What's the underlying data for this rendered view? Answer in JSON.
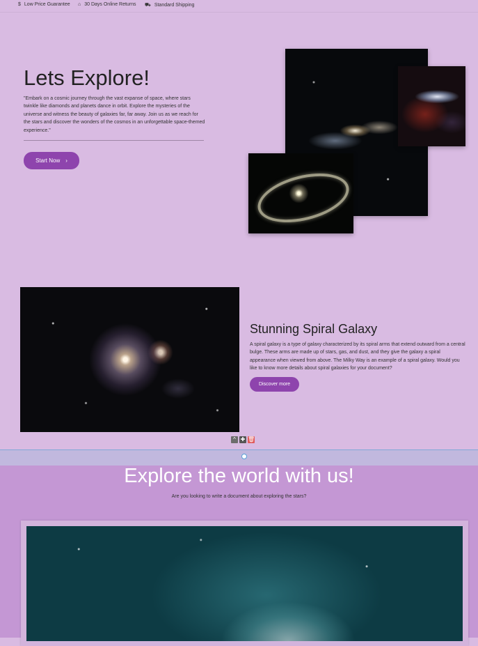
{
  "topbar": {
    "items": [
      {
        "icon": "dollar-icon",
        "glyph": "$",
        "label": "Low Price Guarantee"
      },
      {
        "icon": "store-icon",
        "glyph": "⌂",
        "label": "30 Days Online Returns"
      },
      {
        "icon": "truck-icon",
        "glyph": "⛟",
        "label": "Standard Shipping"
      }
    ]
  },
  "hero": {
    "title": "Lets Explore!",
    "text": "\"Embark on a cosmic journey through the vast expanse of space, where stars twinkle like diamonds and planets dance in orbit. Explore the mysteries of the universe and witness the beauty of galaxies far, far away. Join us as we reach for the stars and discover the wonders of the cosmos in an unforgettable space-themed experience.\"",
    "button_label": "Start Now",
    "button_icon": "chevron-right-icon"
  },
  "galaxy": {
    "title": "Stunning Spiral Galaxy",
    "text": "A spiral galaxy is a type of galaxy characterized by its spiral arms that extend outward from a central bulge. These arms are made up of stars, gas, and dust, and they give the galaxy a spiral appearance when viewed from above. The Milky Way is an example of a spiral galaxy. Would you like to know more details about spiral galaxies for your document?",
    "button_label": "Discover more"
  },
  "block_tools": {
    "up_glyph": "^",
    "move_glyph": "✚",
    "delete_glyph": "🗑"
  },
  "explore": {
    "title": "Explore the world with us!",
    "subtitle": "Are you looking to write a document about exploring the stars?"
  },
  "colors": {
    "background": "#d9bbe2",
    "accent": "#8e44ad",
    "section": "#c497d4"
  }
}
